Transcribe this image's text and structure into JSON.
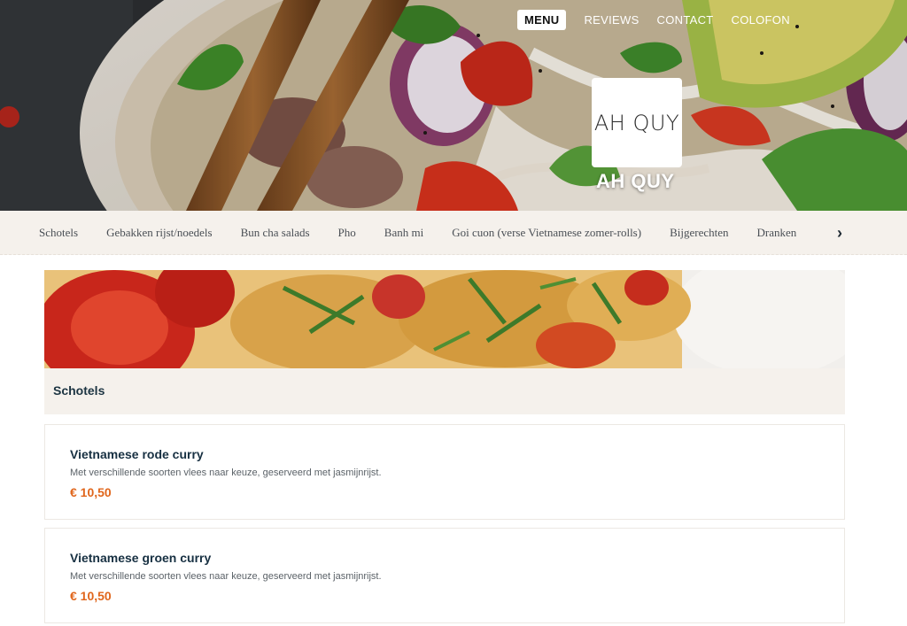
{
  "colors": {
    "accent_price": "#e0661c",
    "heading": "#173042",
    "cream_bg": "#f5f1ec"
  },
  "nav": {
    "items": [
      {
        "label": "MENU",
        "active": true
      },
      {
        "label": "REVIEWS",
        "active": false
      },
      {
        "label": "CONTACT",
        "active": false
      },
      {
        "label": "COLOFON",
        "active": false
      }
    ]
  },
  "brand": {
    "logo_text": "AH QUY",
    "name": "AH QUY"
  },
  "categories": {
    "items": [
      "Schotels",
      "Gebakken rijst/noedels",
      "Bun cha salads",
      "Pho",
      "Banh mi",
      "Goi cuon (verse Vietnamese zomer-rolls)",
      "Bijgerechten",
      "Dranken"
    ],
    "next_icon": "chevron-right-icon"
  },
  "section": {
    "title": "Schotels"
  },
  "dishes": [
    {
      "name": "Vietnamese rode curry",
      "description": "Met verschillende soorten vlees naar keuze, geserveerd met jasmijnrijst.",
      "price": "€ 10,50"
    },
    {
      "name": "Vietnamese groen curry",
      "description": "Met verschillende soorten vlees naar keuze, geserveerd met jasmijnrijst.",
      "price": "€ 10,50"
    }
  ]
}
